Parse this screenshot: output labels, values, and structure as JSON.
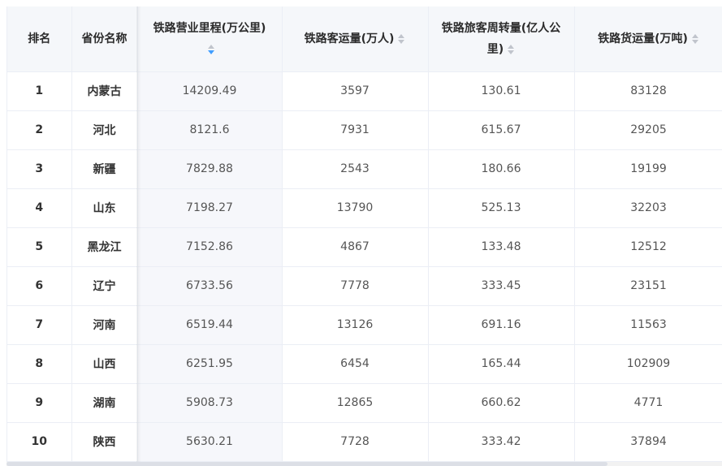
{
  "columns": {
    "rank": "排名",
    "province": "省份名称",
    "rail_length": "铁路营业里程(万公里)",
    "passengers": "铁路客运量(万人)",
    "passenger_turnover": "铁路旅客周转量(亿人公里)",
    "freight": "铁路货运量(万吨)"
  },
  "sort": {
    "column": "rail_length",
    "order": "descending",
    "active_color": "#409eff"
  },
  "rows": [
    {
      "rank": "1",
      "province": "内蒙古",
      "rail_length": "14209.49",
      "passengers": "3597",
      "passenger_turnover": "130.61",
      "freight": "83128"
    },
    {
      "rank": "2",
      "province": "河北",
      "rail_length": "8121.6",
      "passengers": "7931",
      "passenger_turnover": "615.67",
      "freight": "29205"
    },
    {
      "rank": "3",
      "province": "新疆",
      "rail_length": "7829.88",
      "passengers": "2543",
      "passenger_turnover": "180.66",
      "freight": "19199"
    },
    {
      "rank": "4",
      "province": "山东",
      "rail_length": "7198.27",
      "passengers": "13790",
      "passenger_turnover": "525.13",
      "freight": "32203"
    },
    {
      "rank": "5",
      "province": "黑龙江",
      "rail_length": "7152.86",
      "passengers": "4867",
      "passenger_turnover": "133.48",
      "freight": "12512"
    },
    {
      "rank": "6",
      "province": "辽宁",
      "rail_length": "6733.56",
      "passengers": "7778",
      "passenger_turnover": "333.45",
      "freight": "23151"
    },
    {
      "rank": "7",
      "province": "河南",
      "rail_length": "6519.44",
      "passengers": "13126",
      "passenger_turnover": "691.16",
      "freight": "11563"
    },
    {
      "rank": "8",
      "province": "山西",
      "rail_length": "6251.95",
      "passengers": "6454",
      "passenger_turnover": "165.44",
      "freight": "102909"
    },
    {
      "rank": "9",
      "province": "湖南",
      "rail_length": "5908.73",
      "passengers": "12865",
      "passenger_turnover": "660.62",
      "freight": "4771"
    },
    {
      "rank": "10",
      "province": "陕西",
      "rail_length": "5630.21",
      "passengers": "7728",
      "passenger_turnover": "333.42",
      "freight": "37894"
    }
  ]
}
